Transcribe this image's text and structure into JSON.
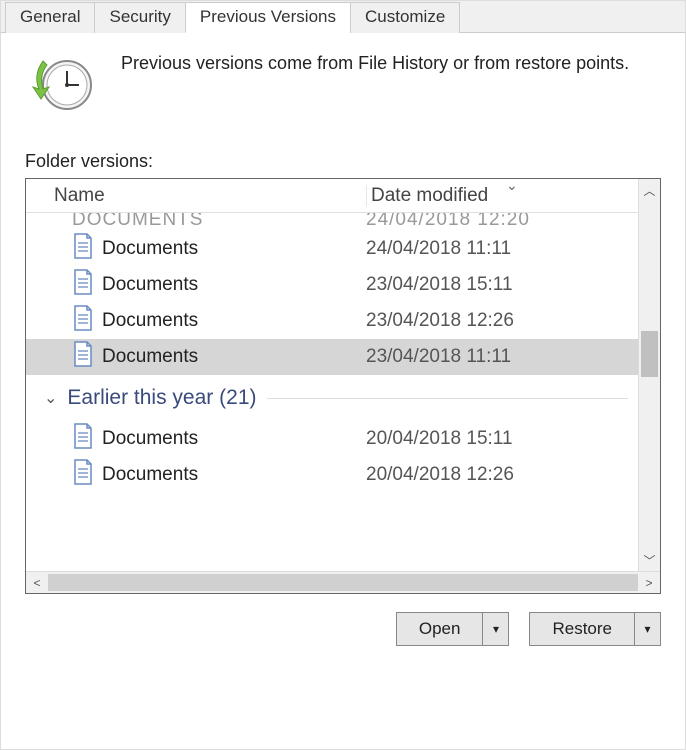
{
  "tabs": {
    "general": "General",
    "security": "Security",
    "previous_versions": "Previous Versions",
    "customize": "Customize"
  },
  "info_text": "Previous versions come from File History or from restore points.",
  "section_label": "Folder versions:",
  "columns": {
    "name": "Name",
    "date": "Date modified"
  },
  "cut_row": {
    "name": "Documents",
    "date": "24/04/2018 12:20"
  },
  "rows": [
    {
      "name": "Documents",
      "date": "24/04/2018 11:11",
      "selected": false
    },
    {
      "name": "Documents",
      "date": "23/04/2018 15:11",
      "selected": false
    },
    {
      "name": "Documents",
      "date": "23/04/2018 12:26",
      "selected": false
    },
    {
      "name": "Documents",
      "date": "23/04/2018 11:11",
      "selected": true
    }
  ],
  "group": {
    "label": "Earlier this year",
    "count": "(21)"
  },
  "rows2": [
    {
      "name": "Documents",
      "date": "20/04/2018 15:11"
    },
    {
      "name": "Documents",
      "date": "20/04/2018 12:26"
    }
  ],
  "buttons": {
    "open": "Open",
    "restore": "Restore"
  }
}
